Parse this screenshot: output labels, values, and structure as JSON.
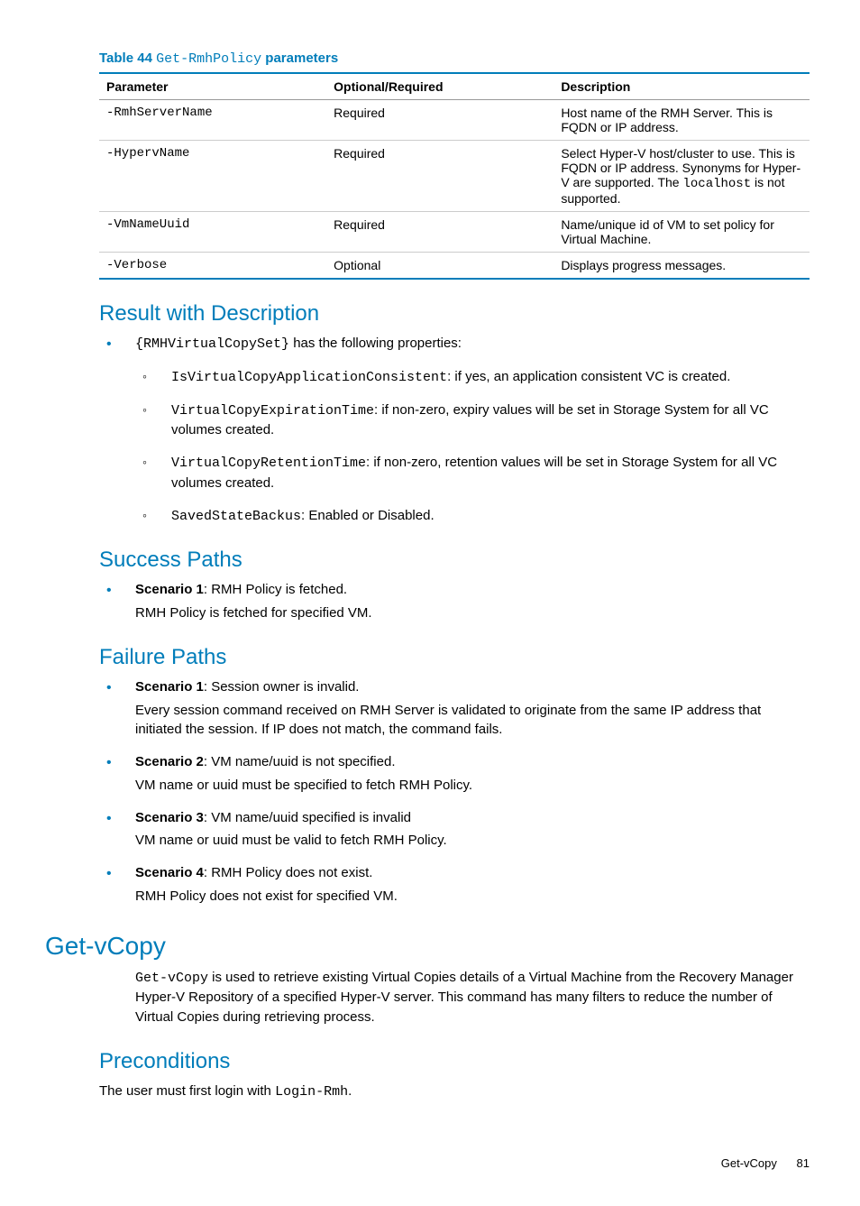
{
  "table": {
    "caption_prefix": "Table 44 ",
    "caption_code": "Get-RmhPolicy",
    "caption_suffix": " parameters",
    "headers": {
      "param": "Parameter",
      "opt": "Optional/Required",
      "desc": "Description"
    },
    "rows": [
      {
        "param": "-RmhServerName",
        "opt": "Required",
        "desc_pre": "Host name of the RMH Server. This is FQDN or IP address.",
        "desc_code": "",
        "desc_post": ""
      },
      {
        "param": "-HypervName",
        "opt": "Required",
        "desc_pre": "Select Hyper-V host/cluster to use. This is FQDN or IP address. Synonyms for Hyper-V are supported. The ",
        "desc_code": "localhost",
        "desc_post": " is not supported."
      },
      {
        "param": "-VmNameUuid",
        "opt": "Required",
        "desc_pre": "Name/unique id of VM to set policy for Virtual Machine.",
        "desc_code": "",
        "desc_post": ""
      },
      {
        "param": "-Verbose",
        "opt": "Optional",
        "desc_pre": "Displays progress messages.",
        "desc_code": "",
        "desc_post": ""
      }
    ]
  },
  "result": {
    "heading": "Result with Description",
    "intro_code": "{RMHVirtualCopySet}",
    "intro_rest": " has the following properties:",
    "items": [
      {
        "code": "IsVirtualCopyApplicationConsistent",
        "rest": ": if yes, an application consistent VC is created."
      },
      {
        "code": "VirtualCopyExpirationTime",
        "rest": ": if non-zero, expiry values will be set in Storage System for all VC volumes created."
      },
      {
        "code": "VirtualCopyRetentionTime",
        "rest": ": if non-zero, retention values will be set in Storage System for all VC volumes created."
      },
      {
        "code": "SavedStateBackus",
        "rest": ": Enabled or Disabled."
      }
    ]
  },
  "success": {
    "heading": "Success Paths",
    "items": [
      {
        "label": "Scenario 1",
        "head": ": RMH Policy is fetched.",
        "body": "RMH Policy is fetched for specified VM."
      }
    ]
  },
  "failure": {
    "heading": "Failure Paths",
    "items": [
      {
        "label": "Scenario 1",
        "head": ": Session owner is invalid.",
        "body": "Every session command received on RMH Server is validated to originate from the same IP address that initiated the session. If IP does not match, the command fails."
      },
      {
        "label": "Scenario 2",
        "head": ": VM name/uuid is not specified.",
        "body": "VM name or uuid must be specified to fetch RMH Policy."
      },
      {
        "label": "Scenario 3",
        "head": ": VM name/uuid specified is invalid",
        "body": "VM name or uuid must be valid to fetch RMH Policy."
      },
      {
        "label": "Scenario 4",
        "head": ": RMH Policy does not exist.",
        "body": "RMH Policy does not exist for specified VM."
      }
    ]
  },
  "getvcopy": {
    "heading": "Get-vCopy",
    "para_code": "Get-vCopy",
    "para_rest": " is used to retrieve existing Virtual Copies details of a Virtual Machine from the Recovery Manager Hyper-V Repository of a specified Hyper-V server. This command has many filters to reduce the number of Virtual Copies during retrieving process."
  },
  "precond": {
    "heading": "Preconditions",
    "text_pre": "The user must first login with ",
    "text_code": "Login-Rmh",
    "text_post": "."
  },
  "footer": {
    "title": "Get-vCopy",
    "page": "81"
  }
}
